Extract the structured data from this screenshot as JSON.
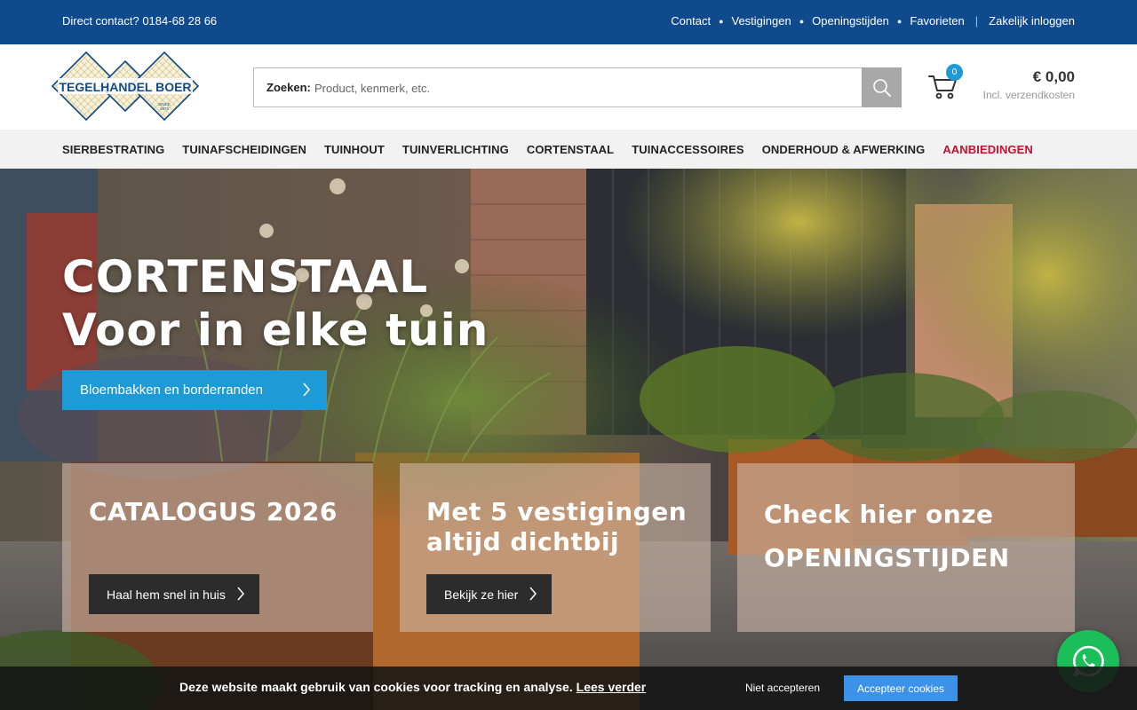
{
  "topbar": {
    "direct_contact": "Direct contact? 0184-68 28 66",
    "links": [
      "Contact",
      "Vestigingen",
      "Openingstijden",
      "Favorieten"
    ],
    "business_login": "Zakelijk inloggen"
  },
  "logo": {
    "text": "TEGELHANDEL BOER",
    "since": "SINCE",
    "year": "1972"
  },
  "search": {
    "label": "Zoeken:",
    "placeholder": "Product, kenmerk, etc.",
    "value": ""
  },
  "cart": {
    "count": "0",
    "amount": "€ 0,00",
    "shipping_note": "Incl. verzendkosten"
  },
  "nav": {
    "items": [
      "SIERBESTRATING",
      "TUINAFSCHEIDINGEN",
      "TUINHOUT",
      "TUINVERLICHTING",
      "CORTENSTAAL",
      "TUINACCESSOIRES",
      "ONDERHOUD & AFWERKING"
    ],
    "sale": "AANBIEDINGEN"
  },
  "hero": {
    "title_line1": "CORTENSTAAL",
    "title_line2": "Voor in elke tuin",
    "button": "Bloembakken en borderranden"
  },
  "cards": [
    {
      "title": "CATALOGUS 2026",
      "button": "Haal hem snel in huis"
    },
    {
      "title_line1": "Met 5 vestigingen",
      "title_line2": "altijd dichtbij",
      "button": "Bekijk ze hier"
    },
    {
      "title_line1": "Check hier onze",
      "title_line2": "OPENINGSTIJDEN"
    }
  ],
  "cookie": {
    "message": "Deze website maakt gebruik van cookies voor tracking en analyse.",
    "read_more": "Lees verder",
    "decline": "Niet accepteren",
    "accept": "Accepteer cookies"
  },
  "colors": {
    "topbar": "#0f4a8c",
    "accent_blue": "#1e9ad6",
    "sale_red": "#c8102e",
    "whatsapp_green": "#1bbf5a"
  },
  "icons": [
    "search-icon",
    "cart-icon",
    "chevron-right-icon",
    "whatsapp-icon"
  ]
}
